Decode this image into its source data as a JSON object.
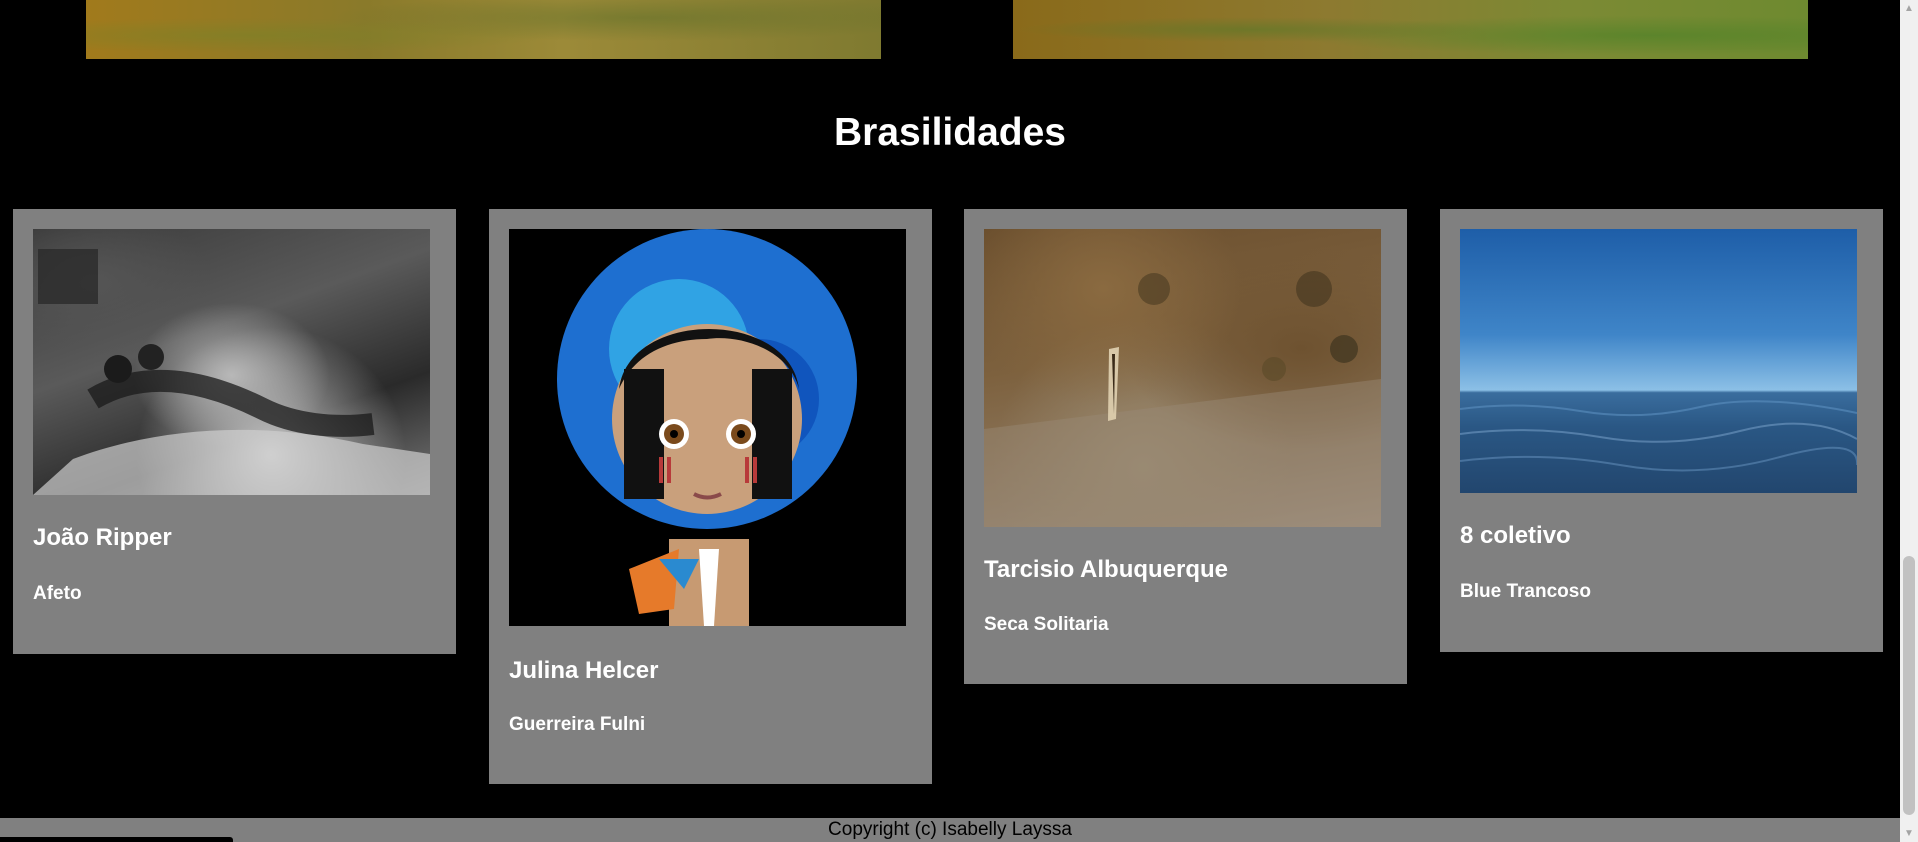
{
  "section": {
    "title": "Brasilidades"
  },
  "cards": [
    {
      "artist": "João Ripper",
      "work": "Afeto"
    },
    {
      "artist": "Julina Helcer",
      "work": "Guerreira Fulni"
    },
    {
      "artist": "Tarcisio Albuquerque",
      "work": "Seca Solitaria"
    },
    {
      "artist": "8 coletivo",
      "work": "Blue Trancoso"
    }
  ],
  "footer": {
    "copyright": "Copyright (c) Isabelly Layssa"
  },
  "scrollbar": {
    "up_icon": "scroll-up-arrow-icon",
    "down_icon": "scroll-down-arrow-icon"
  }
}
